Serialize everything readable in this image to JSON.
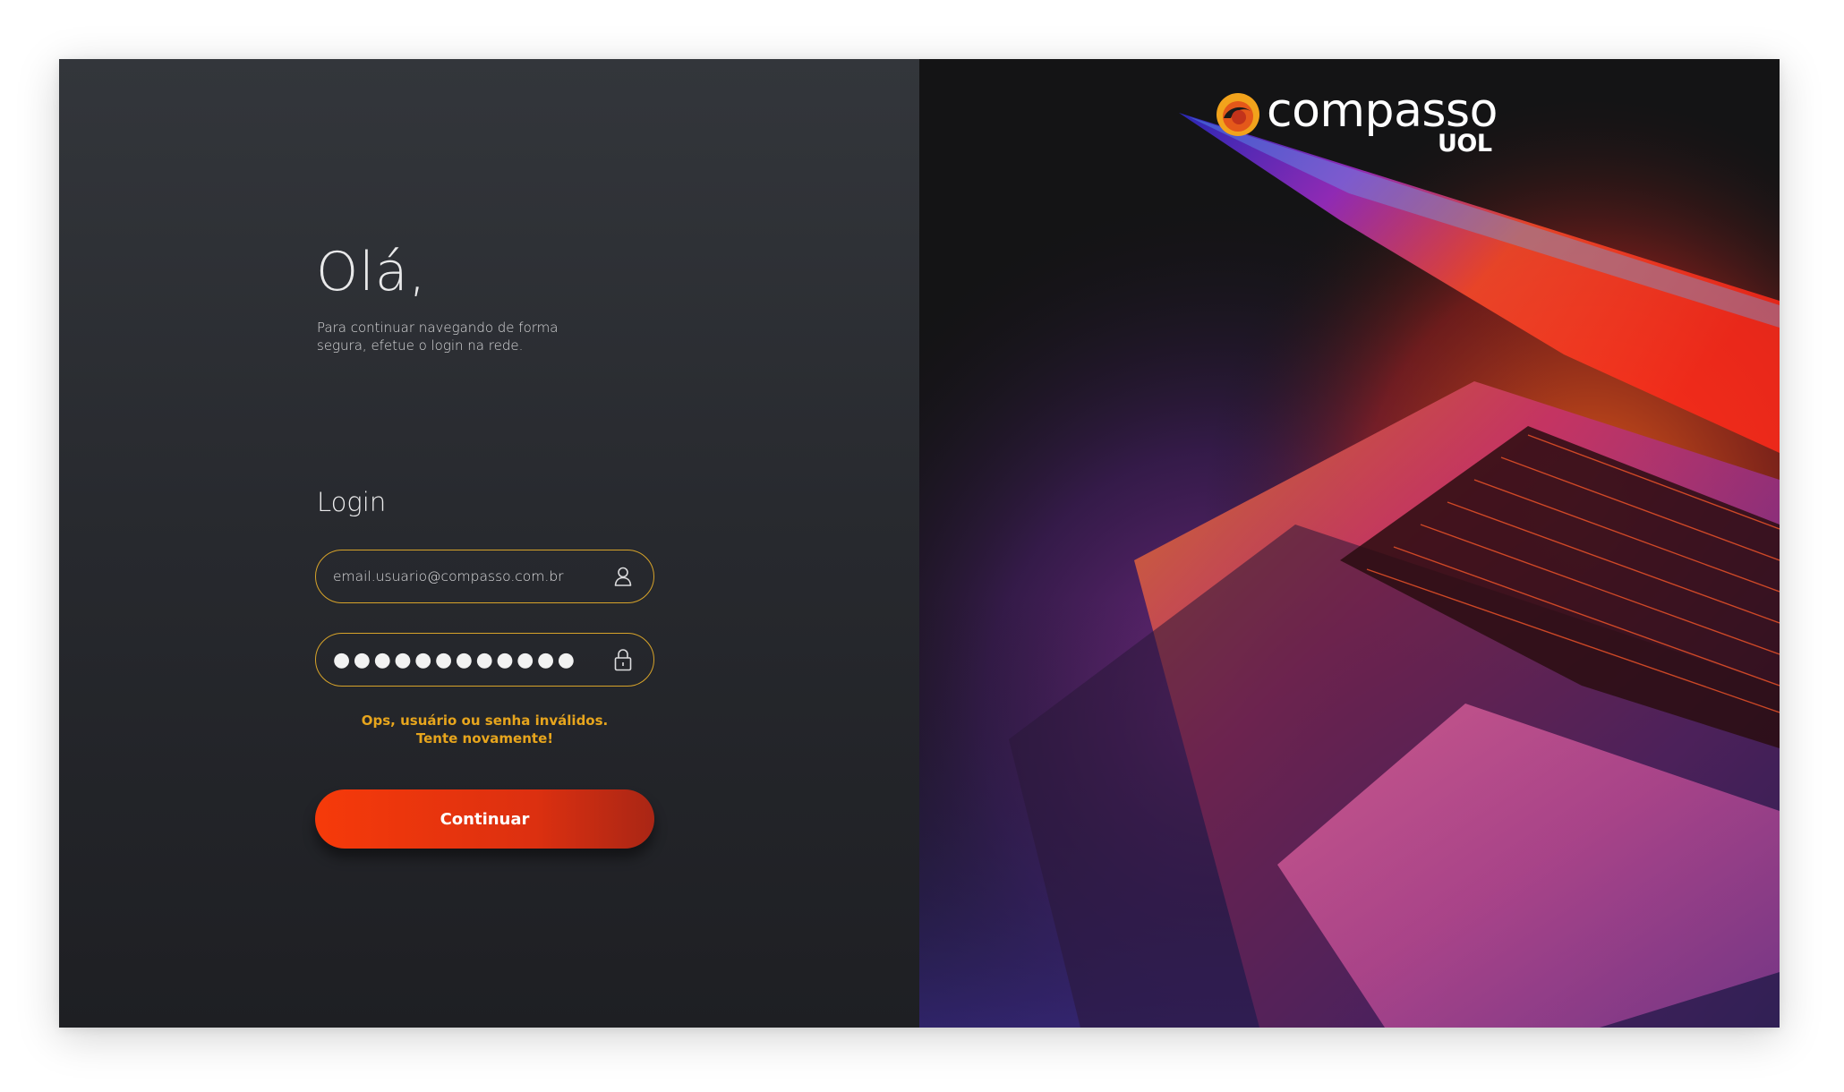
{
  "greeting": "Olá,",
  "subtitle": "Para continuar navegando de forma segura, efetue o login na rede.",
  "login": {
    "title": "Login",
    "email_value": "email.usuario@compasso.com.br",
    "email_icon": "user-icon",
    "password_mask": "●●●●●●●●●●●●",
    "password_icon": "lock-icon",
    "error_line1": "Ops, usuário ou senha inválidos.",
    "error_line2": "Tente novamente!",
    "submit_label": "Continuar"
  },
  "brand": {
    "name": "compasso",
    "sub": "UOL"
  },
  "colors": {
    "accent": "#d7a32a",
    "error": "#e7a51d",
    "button": "#f23a0c",
    "panel": "#2b2e33"
  }
}
